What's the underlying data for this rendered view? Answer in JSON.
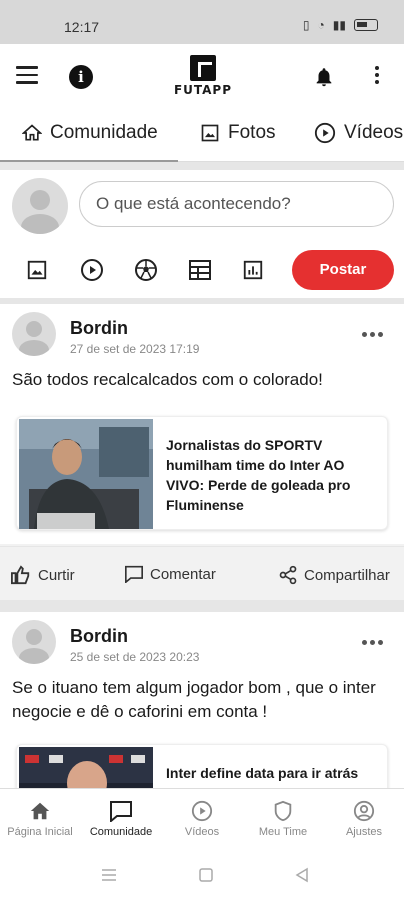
{
  "status_bar": {
    "time": "12:17"
  },
  "app": {
    "logo_text": "FUTAPP"
  },
  "tabs": [
    {
      "label": "Comunidade",
      "icon": "home-icon"
    },
    {
      "label": "Fotos",
      "icon": "image-icon"
    },
    {
      "label": "Vídeos",
      "icon": "play-icon"
    }
  ],
  "composer": {
    "placeholder": "O que está acontecendo?",
    "post_button": "Postar",
    "tools": [
      "image-icon",
      "play-icon",
      "soccer-ball-icon",
      "table-icon",
      "bar-chart-icon"
    ]
  },
  "posts": [
    {
      "author": "Bordin",
      "date": "27 de set de 2023 17:19",
      "text": "São todos recalcalcados com o colorado!",
      "link_title": "Jornalistas do SPORTV humilham time do Inter AO VIVO: Perde de goleada pro Fluminense"
    },
    {
      "author": "Bordin",
      "date": "25 de set de 2023 20:23",
      "text": "Se o ituano tem algum jogador bom , que o inter negocie e dê o caforini em conta !",
      "link_title": "Inter define data para ir atrás"
    }
  ],
  "post_actions": {
    "like": "Curtir",
    "comment": "Comentar",
    "share": "Compartilhar"
  },
  "bottom_nav": [
    {
      "label": "Página Inicial",
      "icon": "home-icon"
    },
    {
      "label": "Comunidade",
      "icon": "chat-icon"
    },
    {
      "label": "Vídeos",
      "icon": "play-icon"
    },
    {
      "label": "Meu Time",
      "icon": "shield-icon"
    },
    {
      "label": "Ajustes",
      "icon": "account-icon"
    }
  ],
  "colors": {
    "accent": "#e53030"
  }
}
